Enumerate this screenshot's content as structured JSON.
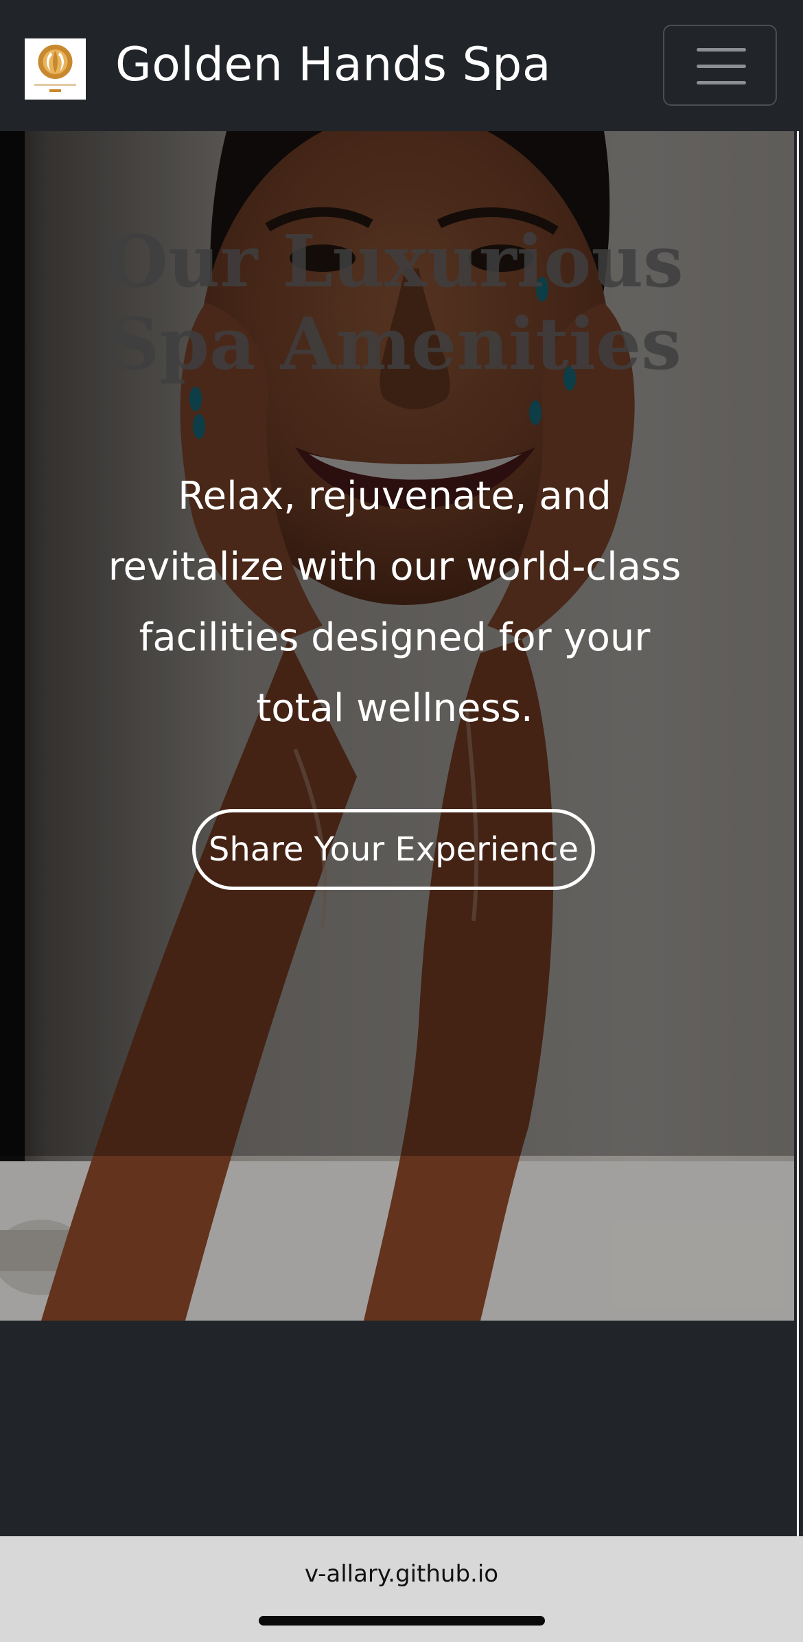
{
  "navbar": {
    "brand_name": "Golden Hands Spa",
    "logo_text": "GOLDEN HANDS",
    "logo_subtext": "SPA",
    "toggle_icon": "hamburger-menu-icon",
    "background_color": "#212429"
  },
  "hero": {
    "title": "Our Luxurious Spa Amenities",
    "description": "Relax, rejuvenate, and revitalize with our world-class facilities designed for your total wellness.",
    "cta_label": "Share Your Experience",
    "image_subject": "woman smiling while washing her face"
  },
  "browser": {
    "url": "v-allary.github.io"
  },
  "colors": {
    "brand_gold": "#c8882e",
    "page_dark": "#212429",
    "text_light": "#ffffff",
    "browser_bar": "#d8d8d8"
  }
}
